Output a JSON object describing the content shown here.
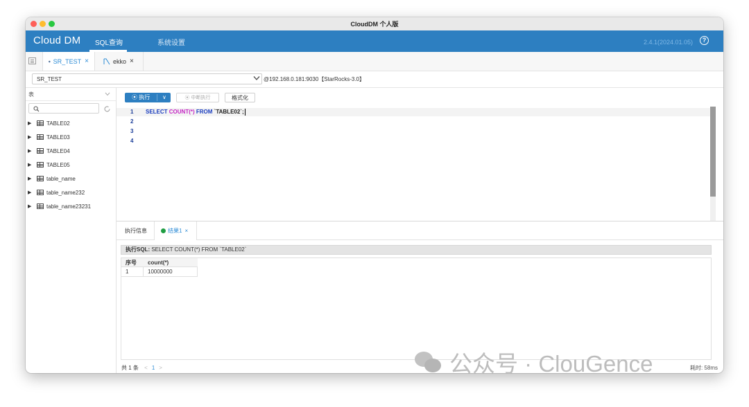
{
  "window": {
    "title": "CloudDM 个人版"
  },
  "app": {
    "logo": "Cloud DM",
    "nav": [
      "SQL查询",
      "系统设置"
    ],
    "version": "2.4.1(2024.01.05)",
    "help_glyph": "?"
  },
  "tabs": [
    {
      "label": "SR_TEST",
      "close": "×",
      "icon": "starrocks-icon"
    },
    {
      "label": "ekko",
      "close": "×",
      "icon": "sql-file-icon"
    }
  ],
  "connection": {
    "database": "SR_TEST",
    "info": "@192.168.0.181:9030【StarRocks-3.0】"
  },
  "sidebar": {
    "type_label": "表",
    "search_placeholder": "",
    "tables": [
      "TABLE02",
      "TABLE03",
      "TABLE04",
      "TABLE05",
      "table_name",
      "table_name232",
      "table_name23231"
    ]
  },
  "toolbar": {
    "execute": "⦿ 执行",
    "dropdown": "∨",
    "stop": "⦿ 中断执行",
    "format": "格式化"
  },
  "editor": {
    "line_numbers": [
      "1",
      "2",
      "3",
      "4"
    ],
    "sql": {
      "select": "SELECT ",
      "func": "COUNT(*)",
      "from": " FROM ",
      "table": "`TABLE02`;"
    }
  },
  "results": {
    "tabs": [
      "执行信息",
      "结果1"
    ],
    "result_close": "×",
    "sql_label": "执行SQL:",
    "sql_text": " SELECT COUNT(*) FROM `TABLE02`",
    "columns": [
      "序号",
      "count(*)"
    ],
    "rows": [
      [
        "1",
        "10000000"
      ]
    ],
    "pager": {
      "total": "共 1 条",
      "prev": "<",
      "page": "1",
      "next": ">"
    },
    "timing": "耗时: 58ms"
  },
  "watermark": "公众号 · ClouGence"
}
